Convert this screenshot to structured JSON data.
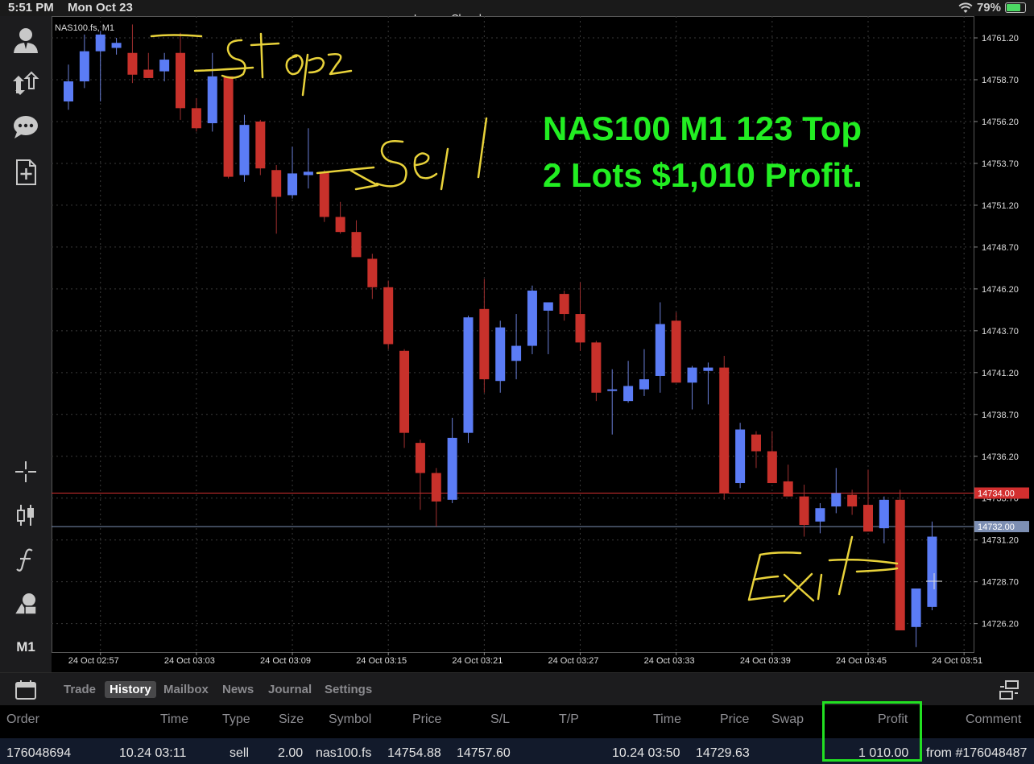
{
  "status": {
    "time": "5:51 PM",
    "date": "Mon Oct 23",
    "account": "Lennox Chambers",
    "battery": "79%",
    "battery_level": 0.79
  },
  "sidebar": {
    "timeframe": "M1"
  },
  "chart": {
    "symbol_label": "NAS100.fs, M1",
    "headline_line1": "NAS100 M1 123 Top",
    "headline_line2": "2 Lots $1,010 Profit.",
    "annotations": {
      "stop": "Stop",
      "sell": "Sell",
      "exit": "Exit"
    },
    "price_tags": [
      {
        "label": "14734.00",
        "value": 14734.0,
        "color": "#d32f2f"
      },
      {
        "label": "14732.00",
        "value": 14732.0,
        "color": "#7d8fb3"
      }
    ],
    "colors": {
      "up": "#5b7cf5",
      "down": "#c8312b",
      "grid": "#3a3a3a",
      "headline": "#22ee22",
      "annotation": "#e8d23a"
    }
  },
  "chart_data": {
    "type": "candlestick",
    "title": "NAS100.fs, M1",
    "ylim": [
      14724.5,
      14762.5
    ],
    "y_ticks": [
      "14726.20",
      "14728.70",
      "14731.20",
      "14733.70",
      "14736.20",
      "14738.70",
      "14741.20",
      "14743.70",
      "14746.20",
      "14748.70",
      "14751.20",
      "14753.70",
      "14756.20",
      "14758.70",
      "14761.20"
    ],
    "x_ticks": [
      {
        "i": 2,
        "label": "24 Oct 02:57"
      },
      {
        "i": 8,
        "label": "24 Oct 03:03"
      },
      {
        "i": 14,
        "label": "24 Oct 03:09"
      },
      {
        "i": 20,
        "label": "24 Oct 03:15"
      },
      {
        "i": 26,
        "label": "24 Oct 03:21"
      },
      {
        "i": 32,
        "label": "24 Oct 03:27"
      },
      {
        "i": 38,
        "label": "24 Oct 03:33"
      },
      {
        "i": 44,
        "label": "24 Oct 03:39"
      },
      {
        "i": 50,
        "label": "24 Oct 03:45"
      },
      {
        "i": 56,
        "label": "24 Oct 03:51"
      }
    ],
    "candles": [
      {
        "o": 14757.4,
        "h": 14759.6,
        "l": 14756.9,
        "c": 14758.6
      },
      {
        "o": 14758.6,
        "h": 14761.4,
        "l": 14758.2,
        "c": 14760.4
      },
      {
        "o": 14760.4,
        "h": 14761.6,
        "l": 14757.4,
        "c": 14761.4
      },
      {
        "o": 14760.6,
        "h": 14761.2,
        "l": 14760.2,
        "c": 14760.9
      },
      {
        "o": 14760.3,
        "h": 14762.0,
        "l": 14758.5,
        "c": 14759.0
      },
      {
        "o": 14759.3,
        "h": 14760.3,
        "l": 14758.8,
        "c": 14758.8
      },
      {
        "o": 14759.2,
        "h": 14760.3,
        "l": 14758.6,
        "c": 14759.9
      },
      {
        "o": 14760.3,
        "h": 14761.5,
        "l": 14756.3,
        "c": 14757.0
      },
      {
        "o": 14757.0,
        "h": 14757.6,
        "l": 14755.6,
        "c": 14755.8
      },
      {
        "o": 14756.1,
        "h": 14760.3,
        "l": 14755.6,
        "c": 14758.9
      },
      {
        "o": 14758.9,
        "h": 14758.9,
        "l": 14752.8,
        "c": 14752.9
      },
      {
        "o": 14753.0,
        "h": 14756.6,
        "l": 14752.6,
        "c": 14756.0
      },
      {
        "o": 14756.2,
        "h": 14756.3,
        "l": 14753.0,
        "c": 14753.4
      },
      {
        "o": 14753.3,
        "h": 14753.6,
        "l": 14749.5,
        "c": 14751.7
      },
      {
        "o": 14751.8,
        "h": 14754.7,
        "l": 14751.6,
        "c": 14753.1
      },
      {
        "o": 14753.0,
        "h": 14755.8,
        "l": 14752.2,
        "c": 14753.2
      },
      {
        "o": 14753.2,
        "h": 14753.3,
        "l": 14750.2,
        "c": 14750.5
      },
      {
        "o": 14750.5,
        "h": 14751.4,
        "l": 14749.5,
        "c": 14749.6
      },
      {
        "o": 14749.6,
        "h": 14750.3,
        "l": 14748.2,
        "c": 14748.1
      },
      {
        "o": 14748.0,
        "h": 14748.3,
        "l": 14745.6,
        "c": 14746.3
      },
      {
        "o": 14746.3,
        "h": 14746.7,
        "l": 14742.6,
        "c": 14742.9
      },
      {
        "o": 14742.5,
        "h": 14742.6,
        "l": 14736.7,
        "c": 14737.6
      },
      {
        "o": 14737.0,
        "h": 14737.2,
        "l": 14733.0,
        "c": 14735.2
      },
      {
        "o": 14735.2,
        "h": 14735.5,
        "l": 14732.0,
        "c": 14733.5
      },
      {
        "o": 14733.6,
        "h": 14738.5,
        "l": 14733.4,
        "c": 14737.3
      },
      {
        "o": 14737.6,
        "h": 14744.6,
        "l": 14737.0,
        "c": 14744.5
      },
      {
        "o": 14745.0,
        "h": 14746.8,
        "l": 14740.0,
        "c": 14740.8
      },
      {
        "o": 14740.7,
        "h": 14744.3,
        "l": 14740.0,
        "c": 14743.9
      },
      {
        "o": 14741.9,
        "h": 14744.7,
        "l": 14740.8,
        "c": 14742.8
      },
      {
        "o": 14742.8,
        "h": 14746.4,
        "l": 14742.3,
        "c": 14746.1
      },
      {
        "o": 14744.9,
        "h": 14745.2,
        "l": 14742.3,
        "c": 14745.4
      },
      {
        "o": 14745.9,
        "h": 14746.1,
        "l": 14744.3,
        "c": 14744.7
      },
      {
        "o": 14744.7,
        "h": 14746.6,
        "l": 14742.5,
        "c": 14743.0
      },
      {
        "o": 14743.0,
        "h": 14743.1,
        "l": 14739.5,
        "c": 14740.0
      },
      {
        "o": 14740.1,
        "h": 14741.4,
        "l": 14737.5,
        "c": 14740.2
      },
      {
        "o": 14739.5,
        "h": 14741.9,
        "l": 14739.4,
        "c": 14740.4
      },
      {
        "o": 14740.2,
        "h": 14742.6,
        "l": 14739.8,
        "c": 14740.8
      },
      {
        "o": 14741.0,
        "h": 14745.4,
        "l": 14740.0,
        "c": 14744.1
      },
      {
        "o": 14744.3,
        "h": 14744.8,
        "l": 14740.6,
        "c": 14740.6
      },
      {
        "o": 14740.6,
        "h": 14741.6,
        "l": 14739.0,
        "c": 14741.5
      },
      {
        "o": 14741.3,
        "h": 14741.8,
        "l": 14739.3,
        "c": 14741.5
      },
      {
        "o": 14741.5,
        "h": 14742.2,
        "l": 14733.6,
        "c": 14734.0
      },
      {
        "o": 14734.6,
        "h": 14738.2,
        "l": 14734.3,
        "c": 14737.8
      },
      {
        "o": 14737.5,
        "h": 14737.7,
        "l": 14735.5,
        "c": 14736.5
      },
      {
        "o": 14736.5,
        "h": 14737.7,
        "l": 14734.8,
        "c": 14734.6
      },
      {
        "o": 14734.7,
        "h": 14735.7,
        "l": 14733.8,
        "c": 14733.8
      },
      {
        "o": 14733.8,
        "h": 14734.5,
        "l": 14731.4,
        "c": 14732.1
      },
      {
        "o": 14732.3,
        "h": 14733.4,
        "l": 14731.6,
        "c": 14733.1
      },
      {
        "o": 14733.2,
        "h": 14735.5,
        "l": 14732.8,
        "c": 14734.0
      },
      {
        "o": 14733.9,
        "h": 14734.2,
        "l": 14732.7,
        "c": 14733.2
      },
      {
        "o": 14733.3,
        "h": 14735.4,
        "l": 14731.8,
        "c": 14731.7
      },
      {
        "o": 14731.9,
        "h": 14733.8,
        "l": 14731.0,
        "c": 14733.6
      },
      {
        "o": 14733.6,
        "h": 14734.2,
        "l": 14726.8,
        "c": 14725.8
      },
      {
        "o": 14726.0,
        "h": 14727.1,
        "l": 14724.8,
        "c": 14728.3
      },
      {
        "o": 14727.2,
        "h": 14732.3,
        "l": 14727.0,
        "c": 14731.4
      }
    ]
  },
  "toolbar": {
    "tabs": [
      {
        "label": "Trade",
        "active": false
      },
      {
        "label": "History",
        "active": true
      },
      {
        "label": "Mailbox",
        "active": false
      },
      {
        "label": "News",
        "active": false
      },
      {
        "label": "Journal",
        "active": false
      },
      {
        "label": "Settings",
        "active": false
      }
    ]
  },
  "history": {
    "headers": {
      "order": "Order",
      "time": "Time",
      "type": "Type",
      "size": "Size",
      "symbol": "Symbol",
      "price": "Price",
      "sl": "S/L",
      "tp": "T/P",
      "close_time": "Time",
      "close_price": "Price",
      "swap": "Swap",
      "profit": "Profit",
      "comment": "Comment"
    },
    "row": {
      "order": "176048694",
      "time": "10.24 03:11",
      "type": "sell",
      "size": "2.00",
      "symbol": "nas100.fs",
      "price": "14754.88",
      "sl": "14757.60",
      "tp": "",
      "close_time": "10.24 03:50",
      "close_price": "14729.63",
      "swap": "",
      "profit": "1 010.00",
      "comment": "from #176048487"
    }
  }
}
